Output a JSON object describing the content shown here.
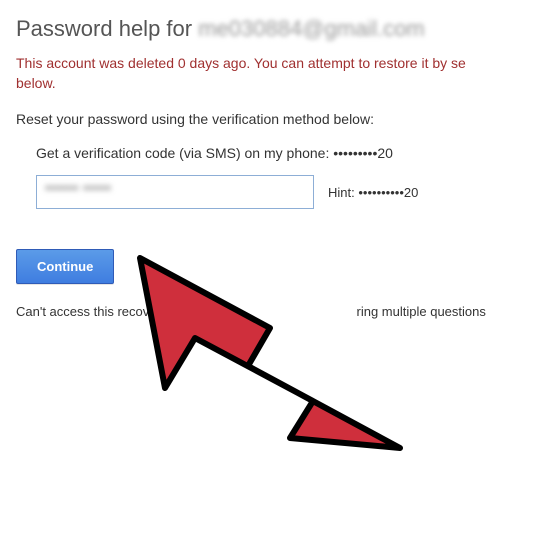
{
  "heading": {
    "prefix": "Password help for ",
    "email_blurred": "me030884@gmail.com"
  },
  "deleted_message": "This account was deleted 0 days ago. You can attempt to restore it by se\nbelow.",
  "instruction": "Reset your password using the verification method below:",
  "sms_line": "Get a verification code (via SMS) on my phone: •••••••••20",
  "input": {
    "value_blurred": "•••••• •••••",
    "hint_label": "Hint:",
    "hint_value": "••••••••••20"
  },
  "continue_label": "Continue",
  "access_line_left": "Can't access this recov",
  "access_line_right": "ring multiple questions",
  "colors": {
    "heading": "#555555",
    "deleted": "#a03030",
    "button_bg": "#4d8de8",
    "button_border": "#2f5bb7",
    "arrow_fill": "#cf2f3c",
    "arrow_stroke": "#000000"
  }
}
